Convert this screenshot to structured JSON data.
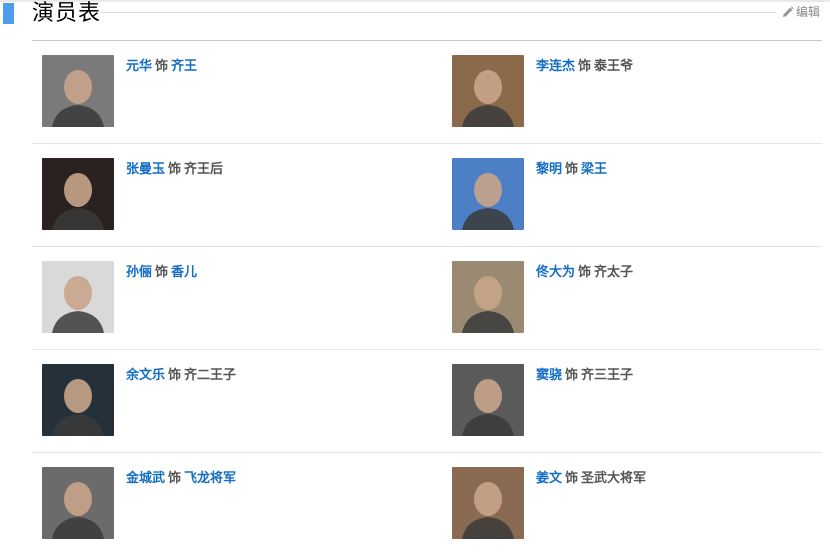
{
  "header": {
    "title": "演员表",
    "edit_label": "编辑"
  },
  "connector": "饰",
  "cast": [
    {
      "actor": "元华",
      "role": "齐王",
      "role_linked": true,
      "photo_bg": "#7a7a7a"
    },
    {
      "actor": "李连杰",
      "role": "泰王爷",
      "role_linked": false,
      "photo_bg": "#8a6a4a"
    },
    {
      "actor": "张曼玉",
      "role": "齐王后",
      "role_linked": false,
      "photo_bg": "#2a2220"
    },
    {
      "actor": "黎明",
      "role": "梁王",
      "role_linked": true,
      "photo_bg": "#4c7fc4"
    },
    {
      "actor": "孙俪",
      "role": "香儿",
      "role_linked": true,
      "photo_bg": "#d9d9d9"
    },
    {
      "actor": "佟大为",
      "role": "齐太子",
      "role_linked": false,
      "photo_bg": "#9b8a72"
    },
    {
      "actor": "余文乐",
      "role": "齐二王子",
      "role_linked": false,
      "photo_bg": "#24303a"
    },
    {
      "actor": "窦骁",
      "role": "齐三王子",
      "role_linked": false,
      "photo_bg": "#5a5a5a"
    },
    {
      "actor": "金城武",
      "role": "飞龙将军",
      "role_linked": true,
      "photo_bg": "#6b6b6b"
    },
    {
      "actor": "姜文",
      "role": "圣武大将军",
      "role_linked": false,
      "photo_bg": "#8a6a50"
    }
  ]
}
